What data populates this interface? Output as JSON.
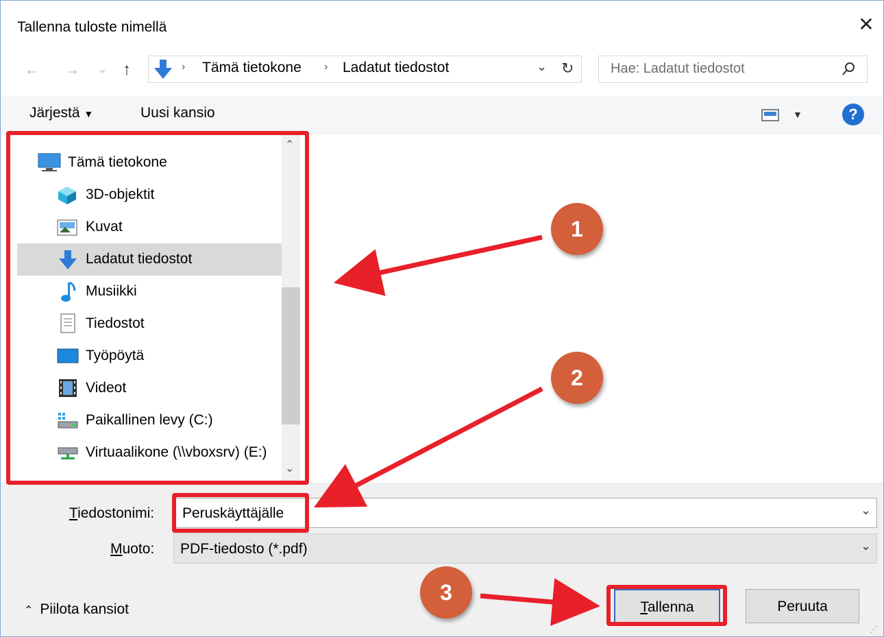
{
  "window": {
    "title": "Tallenna tuloste nimellä"
  },
  "breadcrumb": {
    "root": "Tämä tietokone",
    "current": "Ladatut tiedostot"
  },
  "search": {
    "placeholder": "Hae: Ladatut tiedostot"
  },
  "toolbar": {
    "organize": "Järjestä",
    "new_folder": "Uusi kansio"
  },
  "nav_tree": {
    "root": "Tämä tietokone",
    "items": [
      {
        "label": "3D-objektit",
        "icon": "cube-3d-icon"
      },
      {
        "label": "Kuvat",
        "icon": "pictures-icon"
      },
      {
        "label": "Ladatut tiedostot",
        "icon": "download-arrow-icon",
        "selected": true
      },
      {
        "label": "Musiikki",
        "icon": "music-note-icon"
      },
      {
        "label": "Tiedostot",
        "icon": "document-icon"
      },
      {
        "label": "Työpöytä",
        "icon": "desktop-icon"
      },
      {
        "label": "Videot",
        "icon": "film-icon"
      },
      {
        "label": "Paikallinen levy (C:)",
        "icon": "drive-icon"
      },
      {
        "label": "Virtuaalikone (\\\\vboxsrv) (E:)",
        "icon": "network-drive-icon"
      }
    ]
  },
  "form": {
    "filename_label_u": "T",
    "filename_label_rest": "iedostonimi:",
    "filename_value": "Peruskäyttäjälle",
    "format_label_u": "M",
    "format_label_rest": "uoto:",
    "format_value": "PDF-tiedosto (*.pdf)"
  },
  "footer": {
    "hide_folders": "Piilota kansiot",
    "save_u": "T",
    "save_rest": "allenna",
    "cancel": "Peruuta"
  },
  "annotations": {
    "badges": [
      "1",
      "2",
      "3"
    ],
    "color": "#e8202a",
    "badge_color": "#d35f3b"
  }
}
